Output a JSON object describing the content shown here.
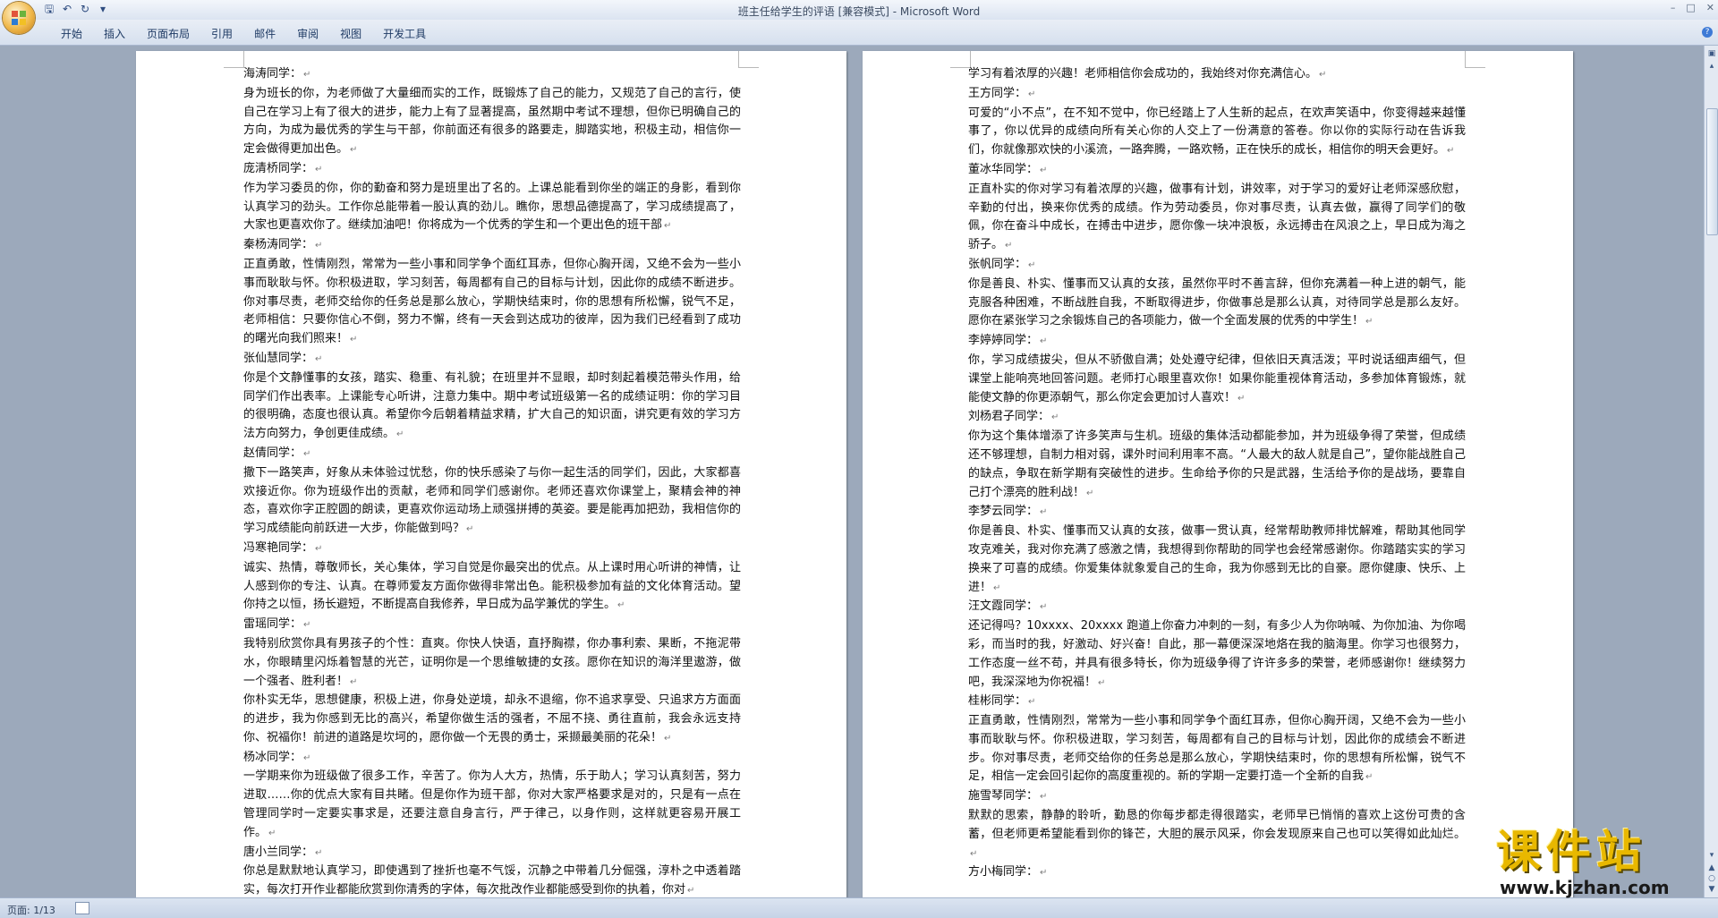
{
  "window": {
    "title": "班主任给学生的评语 [兼容模式] - Microsoft Word"
  },
  "quick_access": {
    "icons": [
      "save-icon",
      "undo-icon",
      "redo-icon",
      "customize-icon"
    ]
  },
  "ribbon": {
    "tabs": [
      "开始",
      "插入",
      "页面布局",
      "引用",
      "邮件",
      "审阅",
      "视图",
      "开发工具"
    ]
  },
  "left_page": {
    "paragraphs": [
      "海涛同学：",
      "身为班长的你，为老师做了大量细而实的工作，既锻炼了自己的能力，又规范了自己的言行，使自己在学习上有了很大的进步，能力上有了显著提高，虽然期中考试不理想，但你已明确自己的方向，为成为最优秀的学生与干部，你前面还有很多的路要走，脚踏实地，积极主动，相信你一定会做得更加出色。",
      "庞清桥同学：",
      "作为学习委员的你，你的勤奋和努力是班里出了名的。上课总能看到你坐的端正的身影，看到你认真学习的劲头。工作你总能带着一股认真的劲儿。瞧你，思想品德提高了，学习成绩提高了，大家也更喜欢你了。继续加油吧！你将成为一个优秀的学生和一个更出色的班干部",
      "秦杨涛同学：",
      "正直勇敢，性情刚烈，常常为一些小事和同学争个面红耳赤，但你心胸开阔，又绝不会为一些小事而耿耿与怀。你积极进取，学习刻苦，每周都有自己的目标与计划，因此你的成绩不断进步。你对事尽责，老师交给你的任务总是那么放心，学期快结束时，你的思想有所松懈，锐气不足，老师相信：只要你信心不倒，努力不懈，终有一天会到达成功的彼岸，因为我们已经看到了成功的曙光向我们照来！",
      "张仙慧同学：",
      "你是个文静懂事的女孩，踏实、稳重、有礼貌；在班里并不显眼，却时刻起着模范带头作用，给同学们作出表率。上课能专心听讲，注意力集中。期中考试班级第一名的成绩证明：你的学习目的很明确，态度也很认真。希望你今后朝着精益求精，扩大自己的知识面，讲究更有效的学习方法方向努力，争创更佳成绩。",
      "赵倩同学：",
      "撒下一路笑声，好象从未体验过忧愁，你的快乐感染了与你一起生活的同学们，因此，大家都喜欢接近你。你为班级作出的贡献，老师和同学们感谢你。老师还喜欢你课堂上，聚精会神的神态，喜欢你字正腔圆的朗读，更喜欢你运动场上顽强拼搏的英姿。要是能再加把劲，我相信你的学习成绩能向前跃进一大步，你能做到吗？",
      "冯寒艳同学：",
      "诚实、热情，尊敬师长，关心集体，学习自觉是你最突出的优点。从上课时用心听讲的神情，让人感到你的专注、认真。在尊师爱友方面你做得非常出色。能积极参加有益的文化体育活动。望你持之以恒，扬长避短，不断提高自我修养，早日成为品学兼优的学生。",
      "雷瑶同学：",
      "我特别欣赏你具有男孩子的个性：直爽。你快人快语，直抒胸襟，你办事利索、果断，不拖泥带水，你眼睛里闪烁着智慧的光芒，证明你是一个思维敏捷的女孩。愿你在知识的海洋里遨游，做一个强者、胜利者！",
      "你朴实无华，思想健康，积极上进，你身处逆境，却永不退缩，你不追求享受、只追求方方面面的进步，我为你感到无比的高兴，希望你做生活的强者，不屈不挠、勇往直前，我会永远支持你、祝福你！前进的道路是坎坷的，愿你做一个无畏的勇士，采撷最美丽的花朵！",
      "杨冰同学：",
      "一学期来你为班级做了很多工作，辛苦了。你为人大方，热情，乐于助人；学习认真刻苦，努力进取……你的优点大家有目共睹。但是你作为班干部，你对大家严格要求是对的，只是有一点在管理同学时一定要实事求是，还要注意自身言行，严于律己，以身作则，这样就更容易开展工作。",
      "唐小兰同学：",
      "你总是默默地认真学习，即使遇到了挫折也毫不气馁，沉静之中带着几分倔强，淳朴之中透着踏实，每次打开作业都能欣赏到你清秀的字体，每次批改作业都能感受到你的执着，你对"
    ]
  },
  "right_page": {
    "paragraphs": [
      "学习有着浓厚的兴趣！老师相信你会成功的，我始终对你充满信心。",
      "王方同学：",
      "可爱的“小不点”，在不知不觉中，你已经踏上了人生新的起点，在欢声笑语中，你变得越来越懂事了，你以优异的成绩向所有关心你的人交上了一份满意的答卷。你以你的实际行动在告诉我们，你就像那欢快的小溪流，一路奔腾，一路欢畅，正在快乐的成长，相信你的明天会更好。",
      "董冰华同学：",
      "正直朴实的你对学习有着浓厚的兴趣，做事有计划，讲效率，对于学习的爱好让老师深感欣慰，辛勤的付出，换来你优秀的成绩。作为劳动委员，你对事尽责，认真去做，赢得了同学们的敬佩，你在奋斗中成长，在搏击中进步，愿你像一块冲浪板，永远搏击在风浪之上，早日成为海之骄子。",
      "张帆同学：",
      "你是善良、朴实、懂事而又认真的女孩，虽然你平时不善言辞，但你充满着一种上进的朝气，能克服各种困难，不断战胜自我，不断取得进步，你做事总是那么认真，对待同学总是那么友好。愿你在紧张学习之余锻炼自己的各项能力，做一个全面发展的优秀的中学生！",
      "李婷婷同学：",
      "你，学习成绩拔尖，但从不骄傲自满；处处遵守纪律，但依旧天真活泼；平时说话细声细气，但课堂上能响亮地回答问题。老师打心眼里喜欢你！如果你能重视体育活动，多参加体育锻炼，就能使文静的你更添朝气，那么你定会更加讨人喜欢！",
      "刘杨君子同学：",
      "你为这个集体增添了许多笑声与生机。班级的集体活动都能参加，并为班级争得了荣誉，但成绩还不够理想，自制力相对弱，课外时间利用率不高。“人最大的敌人就是自己”，望你能战胜自己的缺点，争取在新学期有突破性的进步。生命给予你的只是武器，生活给予你的是战场，要靠自己打个漂亮的胜利战！",
      "李梦云同学：",
      "你是善良、朴实、懂事而又认真的女孩，做事一贯认真，经常帮助教师排忧解难，帮助其他同学攻克难关，我对你充满了感激之情，我想得到你帮助的同学也会经常感谢你。你踏踏实实的学习换来了可喜的成绩。你爱集体就象爱自己的生命，我为你感到无比的自豪。愿你健康、快乐、上进！",
      "汪文霞同学：",
      "还记得吗？10xxxx、20xxxx 跑道上你奋力冲刺的一刻，有多少人为你呐喊、为你加油、为你喝彩，而当时的我，好激动、好兴奋！自此，那一幕便深深地烙在我的脑海里。你学习也很努力，工作态度一丝不苟，并具有很多特长，你为班级争得了许许多多的荣誉，老师感谢你！继续努力吧，我深深地为你祝福！",
      "桂彬同学：",
      "正直勇敢，性情刚烈，常常为一些小事和同学争个面红耳赤，但你心胸开阔，又绝不会为一些小事而耿耿与怀。你积极进取，学习刻苦，每周都有自己的目标与计划，因此你的成绩会不断进步。你对事尽责，老师交给你的任务总是那么放心，学期快结束时，你的思想有所松懈，锐气不足，相信一定会回引起你的高度重视的。新的学期一定要打造一个全新的自我",
      "施雪琴同学：",
      "默默的思索，静静的聆听，勤恳的你每步都走得很踏实，老师早已悄悄的喜欢上这份可贵的含蓄，但老师更希望能看到你的锋芒，大胆的展示风采，你会发现原来自己也可以笑得如此灿烂。",
      "方小梅同学："
    ]
  },
  "status_bar": {
    "page_info": "页面: 1/13"
  },
  "watermark": {
    "text": "课件站",
    "url": "www.kjzhan.com"
  },
  "colors": {
    "accent": "#3d7ad6",
    "watermark": "#e8b800"
  }
}
